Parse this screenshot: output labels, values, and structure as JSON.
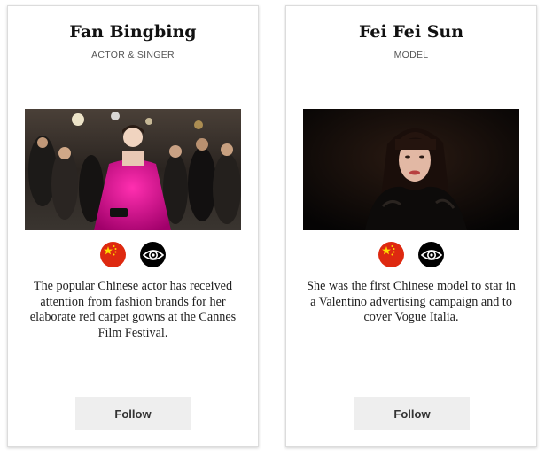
{
  "cards": [
    {
      "name": "Fan Bingbing",
      "role": "ACTOR & SINGER",
      "photo_subject": "woman in magenta strapless gown on red carpet",
      "icons": [
        "china-flag-icon",
        "eye-icon"
      ],
      "description": "The popular Chinese actor has received attention from fashion brands for her elaborate red carpet gowns at the Cannes Film Festival.",
      "follow_label": "Follow"
    },
    {
      "name": "Fei Fei Sun",
      "role": "MODEL",
      "photo_subject": "model with dark hair and bangs in black fur",
      "icons": [
        "china-flag-icon",
        "eye-icon"
      ],
      "description": "She was the first Chinese model to star in a Valentino advertising campaign and to cover Vogue Italia.",
      "follow_label": "Follow"
    }
  ],
  "colors": {
    "flag_red": "#de2910",
    "flag_star": "#ffde00",
    "button_bg": "#eeeeee",
    "gown": "#d4148a"
  }
}
